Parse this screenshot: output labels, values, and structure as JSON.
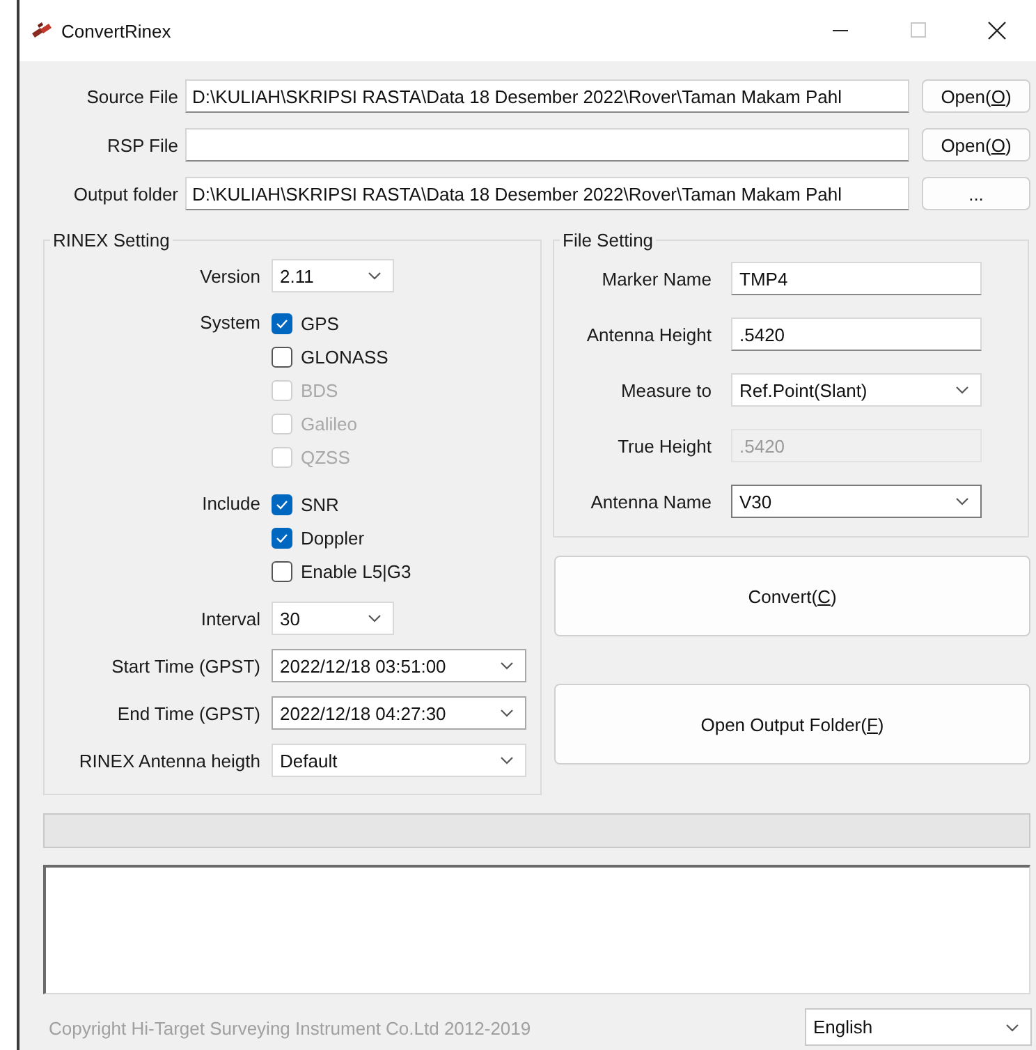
{
  "window": {
    "title": "ConvertRinex"
  },
  "file_rows": [
    {
      "label": "Source File",
      "value": "D:\\KULIAH\\SKRIPSI RASTA\\Data 18 Desember 2022\\Rover\\Taman Makam Pahl",
      "button": [
        {
          "text": "Open(",
          "underline": false
        },
        {
          "text": "O",
          "underline": true
        },
        {
          "text": ")",
          "underline": false
        }
      ]
    },
    {
      "label": "RSP File",
      "button": [
        {
          "text": "Open(",
          "underline": false
        },
        {
          "text": "O",
          "underline": true
        },
        {
          "text": ")",
          "underline": false
        }
      ]
    },
    {
      "label": "Output folder",
      "value": "D:\\KULIAH\\SKRIPSI RASTA\\Data 18 Desember 2022\\Rover\\Taman Makam Pahl",
      "button": [
        {
          "text": "...",
          "underline": false
        }
      ]
    }
  ],
  "rinex_setting": {
    "title": "RINEX Setting",
    "rows": [
      {
        "kind": "dropdown",
        "label": "Version",
        "value": "2.11"
      },
      {
        "kind": "checklist",
        "label": "System",
        "options": [
          {
            "label": "GPS",
            "checked": true,
            "disabled": false
          },
          {
            "label": "GLONASS",
            "checked": false,
            "disabled": false
          },
          {
            "label": "BDS",
            "checked": false,
            "disabled": true
          },
          {
            "label": "Galileo",
            "checked": false,
            "disabled": true
          },
          {
            "label": "QZSS",
            "checked": false,
            "disabled": true
          }
        ]
      },
      {
        "kind": "checklist",
        "label": "Include",
        "options": [
          {
            "label": "SNR",
            "checked": true,
            "disabled": false
          },
          {
            "label": "Doppler",
            "checked": true,
            "disabled": false
          },
          {
            "label": "Enable L5|G3",
            "checked": false,
            "disabled": false
          }
        ]
      },
      {
        "kind": "dropdown",
        "label": "Interval",
        "value": "30"
      },
      {
        "kind": "picker",
        "label": "Start Time (GPST)",
        "value": "2022/12/18 03:51:00"
      },
      {
        "kind": "picker",
        "label": "End Time (GPST)",
        "value": "2022/12/18 04:27:30"
      },
      {
        "kind": "combo",
        "label": "RINEX Antenna heigth",
        "value": "Default"
      }
    ]
  },
  "file_setting": {
    "title": "File Setting",
    "rows": [
      {
        "kind": "text",
        "label": "Marker Name",
        "value": "TMP4",
        "disabled": false,
        "focused": false
      },
      {
        "kind": "text",
        "label": "Antenna Height",
        "value": ".5420",
        "disabled": false,
        "focused": false
      },
      {
        "kind": "dropdown",
        "label": "Measure to",
        "value": "Ref.Point(Slant)",
        "disabled": false,
        "focused": false
      },
      {
        "kind": "text",
        "label": "True Height",
        "value": ".5420",
        "disabled": true,
        "focused": false
      },
      {
        "kind": "dropdown",
        "label": "Antenna Name",
        "value": "V30",
        "disabled": false,
        "focused": true
      }
    ]
  },
  "actions": [
    [
      {
        "text": "Convert(",
        "underline": false
      },
      {
        "text": "C",
        "underline": true
      },
      {
        "text": ")",
        "underline": false
      }
    ],
    [
      {
        "text": "Open Output Folder(",
        "underline": false
      },
      {
        "text": "F",
        "underline": true
      },
      {
        "text": ")",
        "underline": false
      }
    ]
  ],
  "progress": {
    "level": 0
  },
  "footer": {
    "copyright": "Copyright Hi-Target Surveying Instrument Co.Ltd 2012-2019",
    "language": "English"
  }
}
